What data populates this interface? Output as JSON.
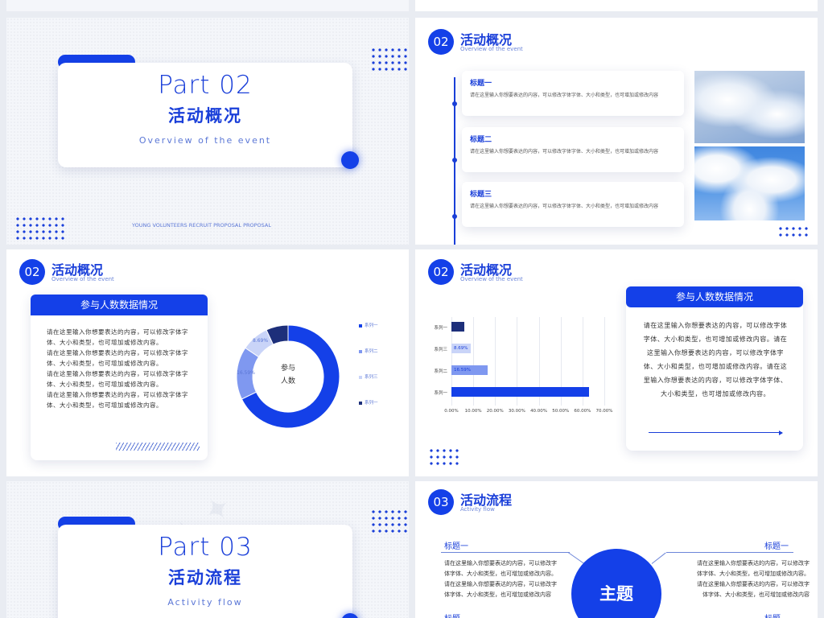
{
  "colors": {
    "primary": "#1440e8",
    "accent_text": "#1a3fd9",
    "light": "#7f98f0",
    "pale": "#c9d4f8",
    "dark": "#1d2f7a"
  },
  "slide1": {
    "part_number": "Part 02",
    "title": "活动概况",
    "subtitle": "Overview of the event",
    "footer": "YOUNG VOLUNTEERS RECRUIT PROPOSAL PROPOSAL"
  },
  "slide2": {
    "number": "02",
    "title": "活动概况",
    "subtitle": "Overview of the event",
    "items": [
      {
        "title": "标题一",
        "text": "请在这里输入你想要表达的内容，可以修改字体字体、大小和类型，也可增加或修改内容"
      },
      {
        "title": "标题二",
        "text": "请在这里输入你想要表达的内容，可以修改字体字体、大小和类型，也可增加或修改内容"
      },
      {
        "title": "标题三",
        "text": "请在这里输入你想要表达的内容，可以修改字体字体、大小和类型，也可增加或修改内容"
      }
    ]
  },
  "slide3": {
    "number": "02",
    "title": "活动概况",
    "subtitle": "Overview of the event",
    "card_header": "参与人数数据情况",
    "paragraphs": [
      "请在这里输入你想要表达的内容，可以修改字体字体、大小和类型，也可增加或修改内容。",
      "请在这里输入你想要表达的内容，可以修改字体字体、大小和类型，也可增加或修改内容。",
      "请在这里输入你想要表达的内容，可以修改字体字体、大小和类型，也可增加或修改内容。",
      "请在这里输入你想要表达的内容，可以修改字体字体、大小和类型，也可增加或修改内容。"
    ],
    "center_label": "参与\n人数",
    "slice_labels": [
      "8.69%",
      "16.59%"
    ],
    "legend": [
      "系列一",
      "系列二",
      "系列三",
      "系列一"
    ]
  },
  "slide4": {
    "number": "02",
    "title": "活动概况",
    "subtitle": "Overview of the event",
    "card_header": "参与人数数据情况",
    "card_text": "请在这里输入你想要表达的内容，可以修改字体字体、大小和类型，也可增加或修改内容。请在这里输入你想要表达的内容，可以修改字体字体、大小和类型，也可增加或修改内容。请在这里输入你想要表达的内容，可以修改字体字体、大小和类型，也可增加或修改内容。",
    "x_ticks": [
      "0.00%",
      "10.00%",
      "20.00%",
      "30.00%",
      "40.00%",
      "50.00%",
      "60.00%",
      "70.00%"
    ]
  },
  "chart_data": [
    {
      "type": "pie",
      "variant": "donut",
      "categories": [
        "系列一",
        "系列二",
        "系列三",
        "系列一"
      ],
      "values": [
        67.8,
        16.59,
        8.69,
        6.92
      ],
      "data_labels": [
        "",
        "16.59%",
        "8.69%",
        ""
      ]
    },
    {
      "type": "bar",
      "orientation": "horizontal",
      "categories": [
        "系列一",
        "系列二",
        "系列三",
        "系列一"
      ],
      "values": [
        63.0,
        16.59,
        8.69,
        6.0
      ],
      "data_labels": [
        "",
        "16.59%",
        "8.69%",
        ""
      ],
      "xlim": [
        0,
        70
      ],
      "grid": true
    }
  ],
  "slide5": {
    "part_number": "Part 03",
    "title": "活动流程",
    "subtitle": "Activity flow"
  },
  "slide6": {
    "number": "03",
    "title": "活动流程",
    "subtitle": "Activity flow",
    "center": "主题",
    "left": {
      "title": "标题一",
      "lines": [
        "请在这里输入你想要表达的内容，可以修改字",
        "体字体、大小和类型，也可增加或修改内容。",
        "请在这里输入你想要表达的内容，可以修改字",
        "体字体、大小和类型，也可增加或修改内容"
      ]
    },
    "right": {
      "title": "标题一",
      "lines": [
        "请在这里输入你想要表达的内容，可以修改字",
        "体字体、大小和类型，也可增加或修改内容。",
        "请在这里输入你想要表达的内容，可以修改字",
        "体字体、大小和类型，也可增加或修改内容"
      ]
    },
    "bottom_left": "标题",
    "bottom_right": "标题"
  }
}
